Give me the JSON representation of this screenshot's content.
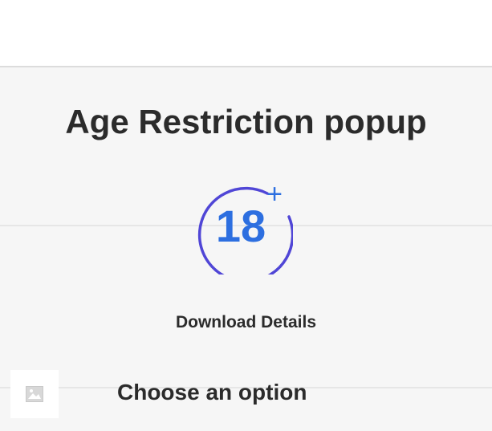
{
  "page": {
    "title": "Age Restriction popup",
    "badge_icon": "age-18-plus-icon",
    "badge_number": "18",
    "badge_plus": "+",
    "download_details": "Download Details",
    "choose_option": "Choose an option",
    "thumbnail_icon": "image-placeholder-icon"
  },
  "colors": {
    "circle": "#5046d6",
    "number": "#2d6fe0",
    "title": "#2b2b2b",
    "background": "#f6f6f6"
  }
}
